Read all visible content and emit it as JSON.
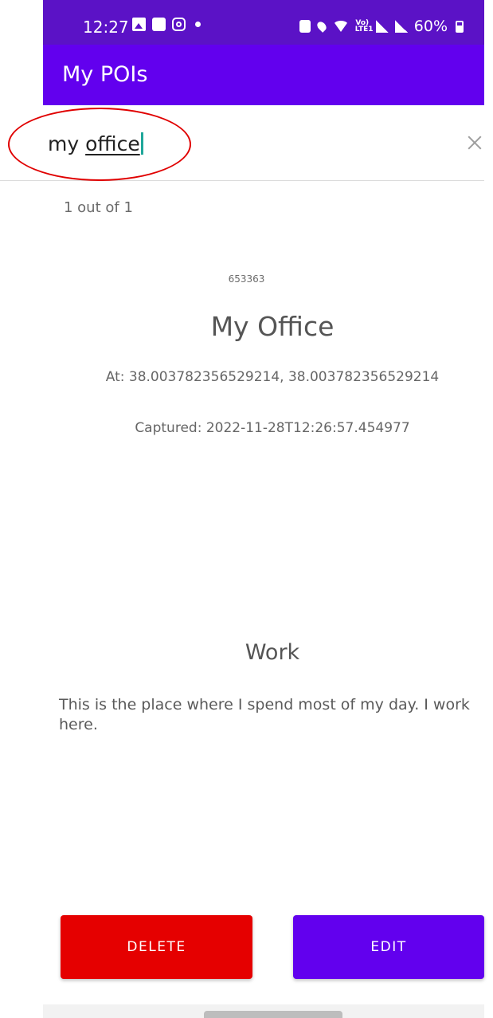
{
  "status_bar": {
    "time": "12:27",
    "volte_top": "Vo)",
    "volte_bottom": "LTE1",
    "battery": "60%"
  },
  "app_bar": {
    "title": "My POIs"
  },
  "search": {
    "value_prefix": "my ",
    "value_underlined": "office",
    "clear_icon": "close-icon"
  },
  "results": {
    "count_text": "1 out of 1"
  },
  "poi": {
    "id": "653363",
    "name": "My Office",
    "coordinates": "At: 38.003782356529214, 38.003782356529214",
    "captured": "Captured: 2022-11-28T12:26:57.454977",
    "category": "Work",
    "description": "This is the place where I spend most of my day. I work here."
  },
  "actions": {
    "delete_label": "DELETE",
    "edit_label": "EDIT"
  },
  "colors": {
    "status_bar": "#5b12c6",
    "app_bar": "#6200ee",
    "delete_button": "#e50000",
    "edit_button": "#6200ee",
    "caret": "#1fa79a",
    "annotation": "#e00000"
  }
}
